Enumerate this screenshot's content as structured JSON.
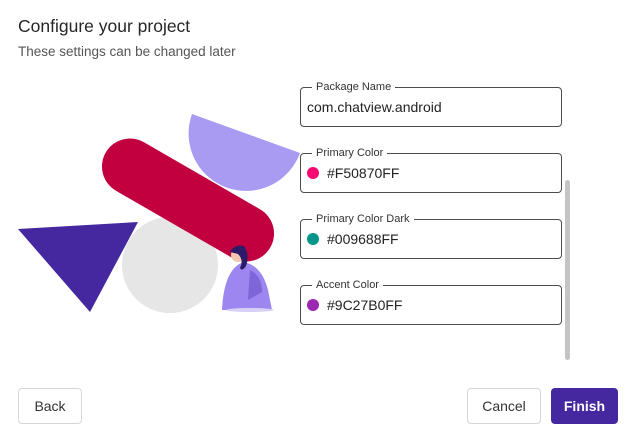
{
  "header": {
    "title": "Configure your project",
    "subtitle": "These settings can be changed later"
  },
  "illustration": {
    "shapes": [
      "triangle",
      "circle",
      "pill",
      "half-circle",
      "person"
    ],
    "colors": {
      "triangle": "#4527a0",
      "circle": "#e6e6e6",
      "pill": "#c2003f",
      "half_circle": "#a99af2",
      "person_hair": "#2d1b69",
      "person_body": "#9e86f0"
    }
  },
  "form": {
    "fields": [
      {
        "label": "Package Name",
        "value": "com.chatview.android"
      },
      {
        "label": "Primary Color",
        "value": "#F50870FF",
        "swatch": "#f50870"
      },
      {
        "label": "Primary Color Dark",
        "value": "#009688FF",
        "swatch": "#009688"
      },
      {
        "label": "Accent Color",
        "value": "#9C27B0FF",
        "swatch": "#9c27b0"
      }
    ]
  },
  "footer": {
    "back_label": "Back",
    "cancel_label": "Cancel",
    "finish_label": "Finish"
  },
  "colors": {
    "accent": "#4527a0"
  }
}
